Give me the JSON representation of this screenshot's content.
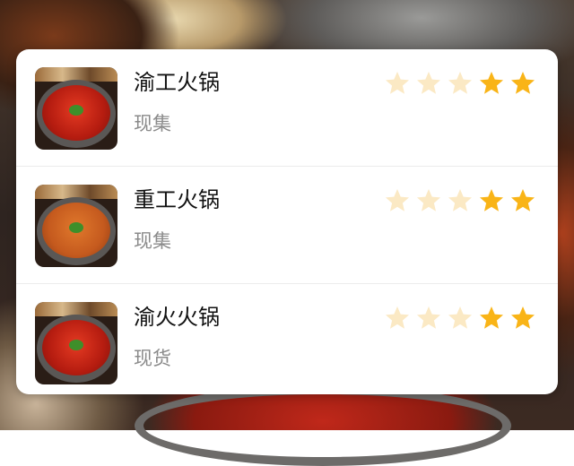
{
  "rating_scale": 5,
  "colors": {
    "star_filled": "#F9B417",
    "star_faded": "#FBE9C4",
    "title": "#111111",
    "subtitle": "#8A8A8A"
  },
  "items": [
    {
      "name": "渝工火锅",
      "status": "现集",
      "rating": 2,
      "thumb_icon": "hotpot-red-image"
    },
    {
      "name": "重工火锅",
      "status": "现集",
      "rating": 2,
      "thumb_icon": "hotpot-orange-image"
    },
    {
      "name": "渝火火锅",
      "status": "现货",
      "rating": 2,
      "thumb_icon": "hotpot-red-image"
    }
  ]
}
